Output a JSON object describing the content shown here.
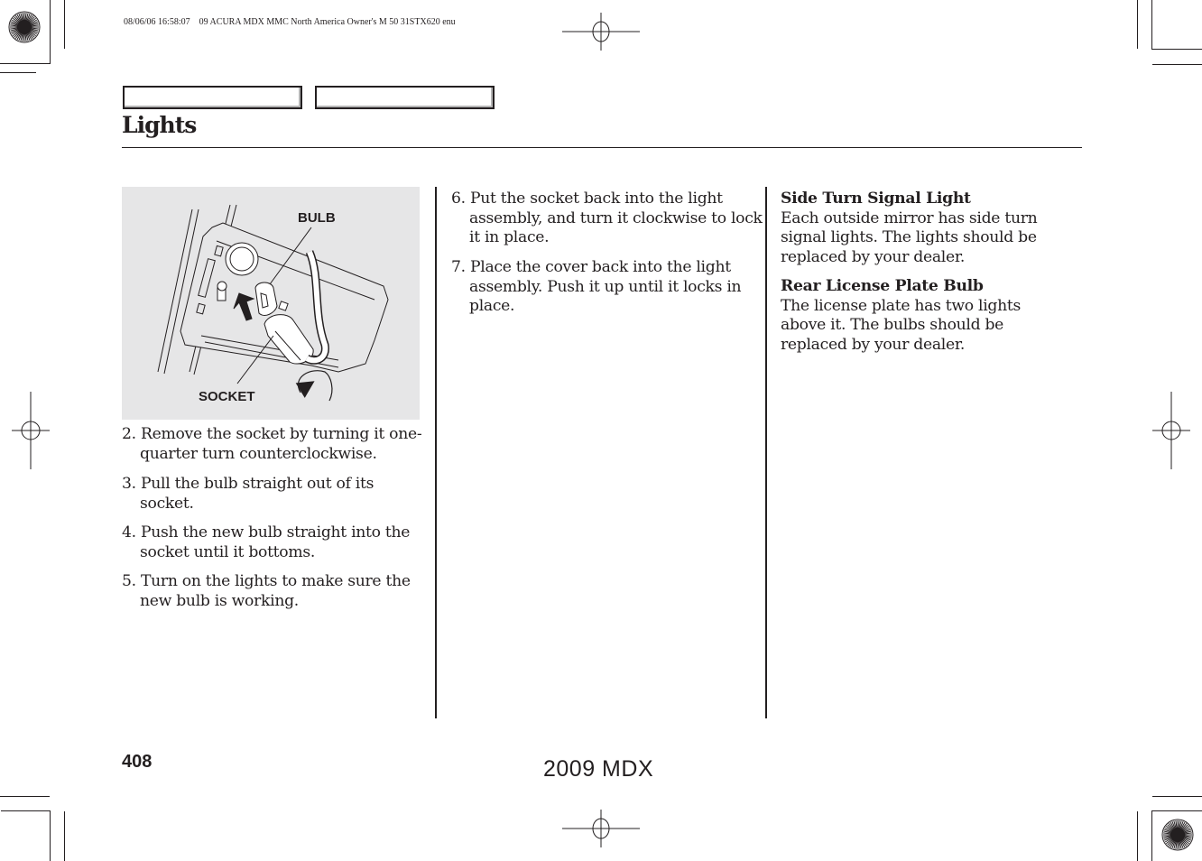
{
  "print_header": "08/06/06 16:58:07    09 ACURA MDX MMC North America Owner's M 50 31STX620 enu",
  "nav_tabs": [
    "",
    ""
  ],
  "page_title": "Lights",
  "figure": {
    "labels": {
      "bulb": "BULB",
      "socket": "SOCKET"
    }
  },
  "column1": {
    "steps": [
      {
        "number": "2.",
        "text": "Remove the socket by turning it one-quarter turn counterclockwise."
      },
      {
        "number": "3.",
        "text": "Pull the bulb straight out of its socket."
      },
      {
        "number": "4.",
        "text": "Push the new bulb straight into the socket until it bottoms."
      },
      {
        "number": "5.",
        "text": "Turn on the lights to make sure the new bulb is working."
      }
    ]
  },
  "column2": {
    "steps": [
      {
        "number": "6.",
        "text": "Put the socket back into the light assembly, and turn it clockwise to lock it in place."
      },
      {
        "number": "7.",
        "text": "Place the cover back into the light assembly. Push it up until it locks in place."
      }
    ]
  },
  "column3": {
    "sections": [
      {
        "heading": "Side Turn Signal Light",
        "body": "Each outside mirror has side turn signal lights. The lights should be replaced by your dealer."
      },
      {
        "heading": "Rear License Plate Bulb",
        "body": "The license plate has two lights above it. The bulbs should be replaced by your dealer."
      }
    ]
  },
  "footer": {
    "page_number": "408",
    "model": "2009  MDX"
  }
}
